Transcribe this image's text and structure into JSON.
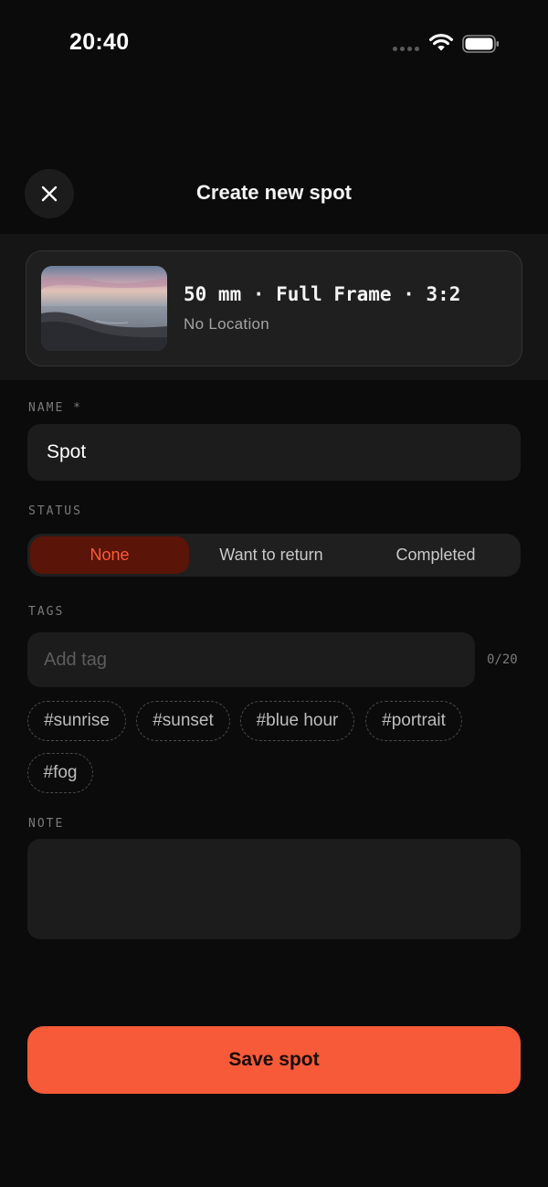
{
  "status_bar": {
    "time": "20:40",
    "icons": [
      "signal-dots-icon",
      "wifi-icon",
      "battery-icon"
    ]
  },
  "header": {
    "title": "Create new spot",
    "close_icon": "close-icon"
  },
  "spot_card": {
    "camera_info": "50 mm · Full Frame · 3:2",
    "location": "No Location",
    "thumbnail": "seascape-photo"
  },
  "form": {
    "name_label": "NAME *",
    "name_value": "Spot",
    "status_label": "STATUS",
    "status_options": [
      "None",
      "Want to return",
      "Completed"
    ],
    "status_selected": "None",
    "tags_label": "TAGS",
    "tags_placeholder": "Add tag",
    "tags_count": "0/20",
    "suggested_tags": [
      "#sunrise",
      "#sunset",
      "#blue hour",
      "#portrait",
      "#fog"
    ],
    "note_label": "NOTE",
    "note_value": ""
  },
  "actions": {
    "save_label": "Save spot"
  },
  "colors": {
    "accent": "#f65a38",
    "active_segment_bg": "#5a1408",
    "active_segment_text": "#ff5a36",
    "background": "#0b0b0b"
  }
}
